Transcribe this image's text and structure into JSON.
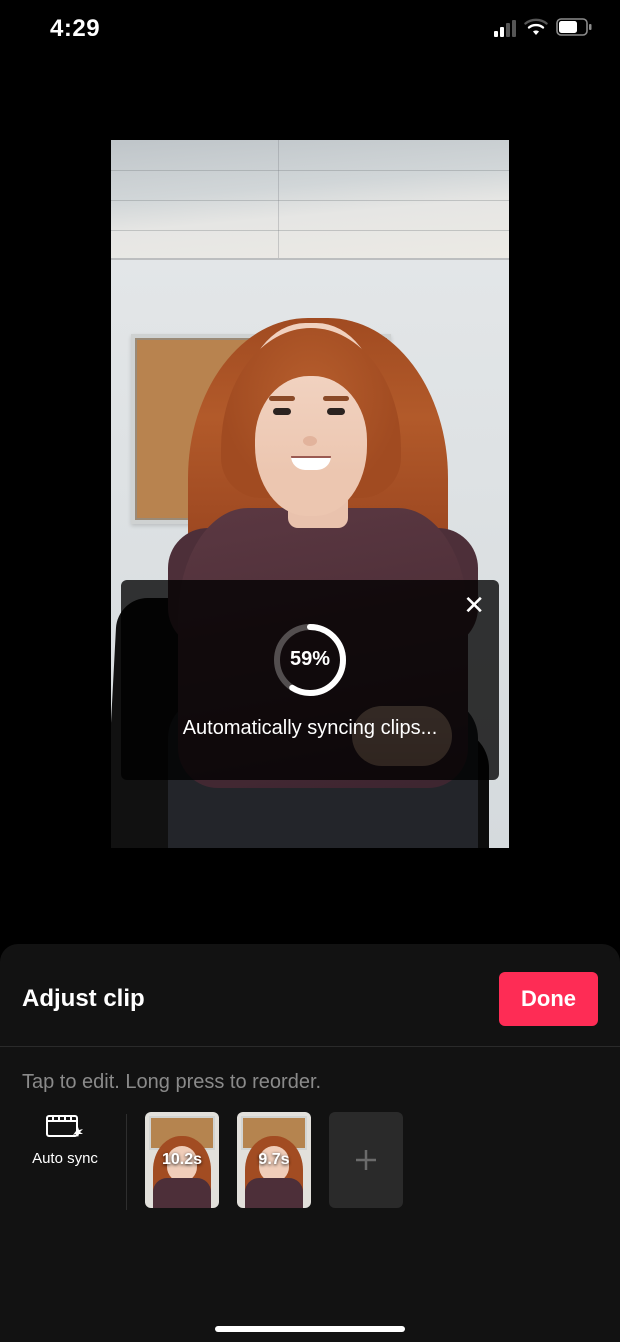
{
  "status": {
    "time": "4:29"
  },
  "overlay": {
    "progress_percent": 59,
    "progress_label": "59%",
    "message": "Automatically syncing clips...",
    "close_glyph": "✕"
  },
  "panel": {
    "title": "Adjust clip",
    "done_label": "Done",
    "hint": "Tap to edit. Long press to reorder.",
    "autosync_label": "Auto sync"
  },
  "clips": [
    {
      "duration": "10.2s",
      "selected": true
    },
    {
      "duration": "9.7s",
      "selected": false
    }
  ],
  "colors": {
    "accent": "#fe2c55"
  }
}
